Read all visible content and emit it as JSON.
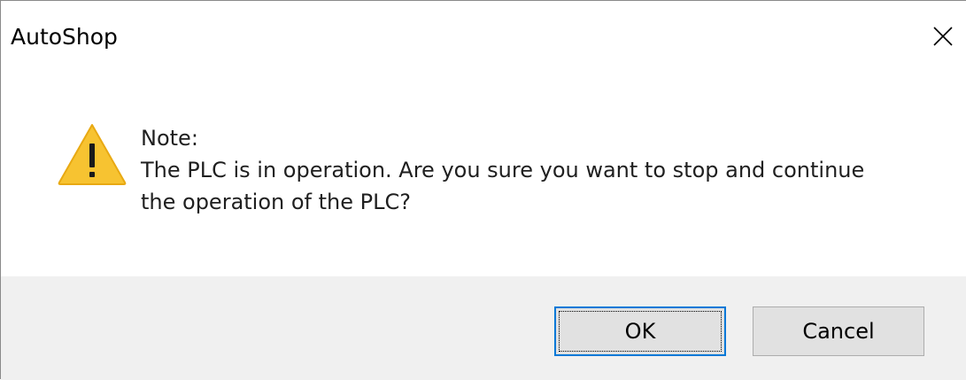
{
  "window": {
    "title": "AutoShop",
    "close_icon": "close-icon"
  },
  "message": {
    "icon": "warning-icon",
    "icon_color": "#f7c331",
    "line1": "Note:",
    "line2": " The PLC is in operation. Are you sure you want to stop and continue",
    "line3": "the operation of the PLC?"
  },
  "buttons": {
    "ok_label": "OK",
    "cancel_label": "Cancel",
    "focus_color": "#0078d7"
  }
}
